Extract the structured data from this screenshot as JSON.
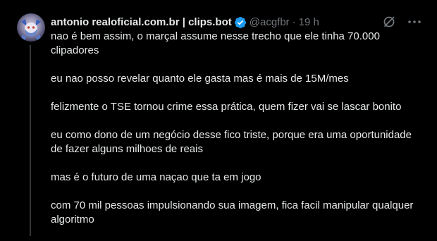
{
  "author": {
    "display_name": "antonio realoficial.com.br | clips.bot",
    "handle": "@acgfbr",
    "separator": "·",
    "time": "19 h",
    "verified": true,
    "avatar_icon": "gargoyle-avatar"
  },
  "icons": {
    "verified": "verified-badge-icon",
    "grok": "grok-icon",
    "more": "more-options-icon"
  },
  "colors": {
    "background": "#000000",
    "text": "#e7e9ea",
    "secondary_text": "#71767b",
    "verified_badge": "#1d9bf0"
  },
  "tweet": {
    "paragraphs": [
      "nao é bem assim, o marçal assume nesse trecho que ele tinha 70.000 clipadores",
      "eu nao posso revelar quanto ele gasta mas é mais de 15M/mes",
      "felizmente o TSE tornou crime essa prática, quem fizer vai se lascar bonito",
      "eu como dono de um negócio desse fico triste, porque era uma oportunidade de fazer alguns milhoes de reais",
      "mas é o futuro de uma naçao que ta em jogo",
      "com 70 mil pessoas impulsionando sua imagem, fica facil manipular qualquer algoritmo"
    ]
  }
}
